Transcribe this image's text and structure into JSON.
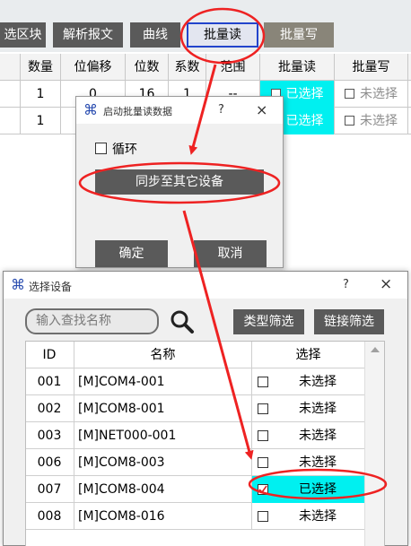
{
  "toolbar": {
    "buttons": [
      {
        "label": "选区块"
      },
      {
        "label": "解析报文"
      },
      {
        "label": "曲线"
      },
      {
        "label": "批量读"
      },
      {
        "label": "批量写"
      }
    ]
  },
  "bg_table": {
    "headers": [
      "数量",
      "位偏移",
      "位数",
      "系数",
      "范围",
      "批量读",
      "批量写"
    ],
    "rows": [
      [
        "1",
        "0",
        "16",
        "1",
        "--",
        "已选择",
        "未选择"
      ],
      [
        "1",
        "",
        "",
        "",
        "",
        "已选择",
        "未选择"
      ]
    ]
  },
  "dialog_batch": {
    "title": "启动批量读数据",
    "help": "?",
    "close": "×",
    "loop_label": "循环",
    "sync_label": "同步至其它设备",
    "ok_label": "确定",
    "cancel_label": "取消"
  },
  "dialog_select": {
    "title": "选择设备",
    "help": "?",
    "close": "×",
    "search_placeholder": "输入查找名称",
    "type_filter": "类型筛选",
    "link_filter": "链接筛选",
    "headers": [
      "ID",
      "名称",
      "选择"
    ],
    "rows": [
      {
        "id": "001",
        "name": "[M]COM4-001",
        "status": "未选择"
      },
      {
        "id": "002",
        "name": "[M]COM8-001",
        "status": "未选择"
      },
      {
        "id": "003",
        "name": "[M]NET000-001",
        "status": "未选择"
      },
      {
        "id": "006",
        "name": "[M]COM8-003",
        "status": "未选择"
      },
      {
        "id": "007",
        "name": "[M]COM8-004",
        "status": "已选择"
      },
      {
        "id": "008",
        "name": "[M]COM8-016",
        "status": "未选择"
      }
    ]
  },
  "colors": {
    "button_dark": "#5a5a5a",
    "selected_cyan": "#00f0f0",
    "annotation_red": "#ee2222",
    "active_border": "#2244cc"
  }
}
